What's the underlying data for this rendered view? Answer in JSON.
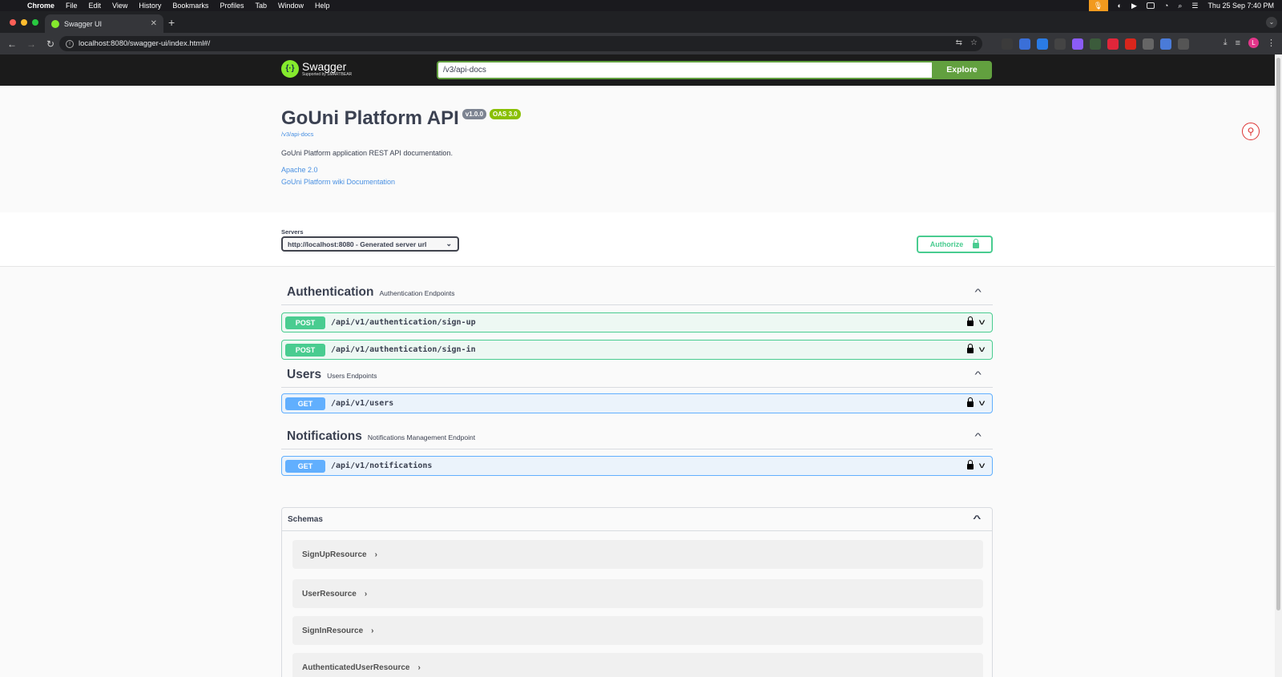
{
  "menubar": {
    "app": "Chrome",
    "items": [
      "File",
      "Edit",
      "View",
      "History",
      "Bookmarks",
      "Profiles",
      "Tab",
      "Window",
      "Help"
    ],
    "clock": "Thu 25 Sep  7:40 PM"
  },
  "browser": {
    "tab_title": "Swagger UI",
    "url": "localhost:8080/swagger-ui/index.html#/",
    "profile_initial": "L"
  },
  "topbar": {
    "logo_name": "Swagger",
    "logo_sub": "Supported by SMARTBEAR",
    "spec_url": "/v3/api-docs",
    "explore_label": "Explore"
  },
  "info": {
    "title": "GoUni Platform API",
    "version": "v1.0.0",
    "oas": "OAS 3.0",
    "spec_link": "/v3/api-docs",
    "description": "GoUni Platform application REST API documentation.",
    "license": "Apache 2.0",
    "external_docs": "GoUni Platform wiki Documentation"
  },
  "servers": {
    "label": "Servers",
    "selected": "http://localhost:8080 - Generated server url",
    "authorize_label": "Authorize"
  },
  "tags": [
    {
      "name": "Authentication",
      "description": "Authentication Endpoints",
      "operations": [
        {
          "method": "POST",
          "path": "/api/v1/authentication/sign-up"
        },
        {
          "method": "POST",
          "path": "/api/v1/authentication/sign-in"
        }
      ]
    },
    {
      "name": "Users",
      "description": "Users Endpoints",
      "operations": [
        {
          "method": "GET",
          "path": "/api/v1/users"
        }
      ]
    },
    {
      "name": "Notifications",
      "description": "Notifications Management Endpoint",
      "operations": [
        {
          "method": "GET",
          "path": "/api/v1/notifications"
        }
      ]
    }
  ],
  "schemas": {
    "title": "Schemas",
    "models": [
      "SignUpResource",
      "UserResource",
      "SignInResource",
      "AuthenticatedUserResource"
    ]
  },
  "colors": {
    "post": "#49cc90",
    "get": "#61affe",
    "swagger_green": "#85ea2d",
    "explore_green": "#62a03f"
  }
}
